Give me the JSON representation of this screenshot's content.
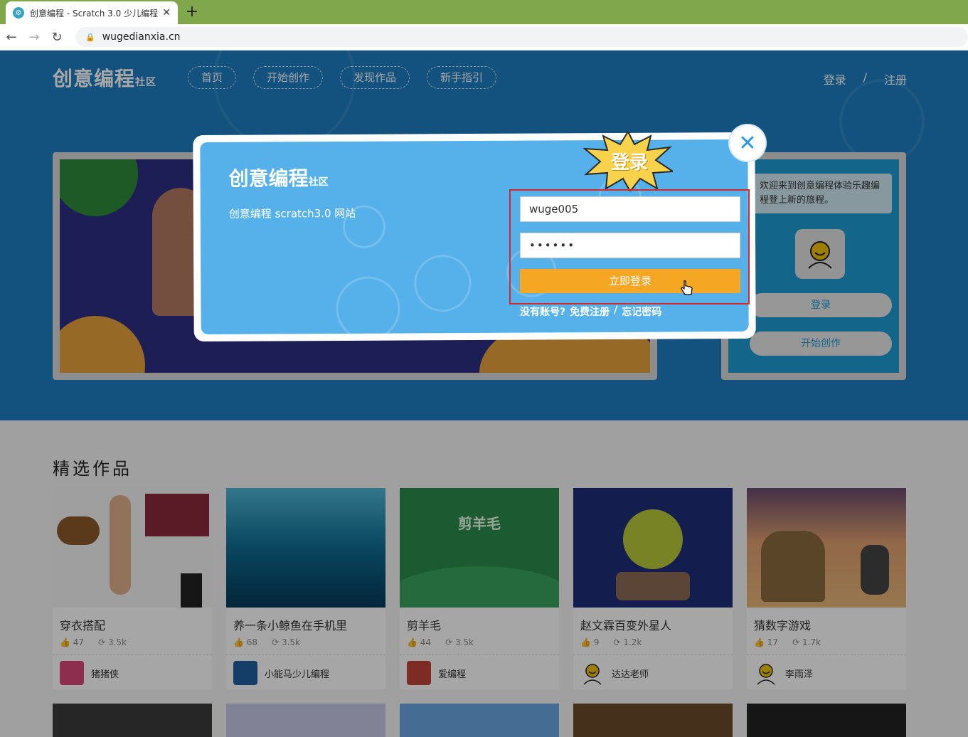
{
  "browser": {
    "tab_title": "创意编程 - Scratch 3.0 少儿编程",
    "tab_close": "✕",
    "new_tab": "+",
    "url": "wugedianxia.cn"
  },
  "site": {
    "logo_main": "创意编程",
    "logo_suffix": "社区",
    "nav": [
      "首页",
      "开始创作",
      "发现作品",
      "新手指引"
    ],
    "login": "登录",
    "separator": "/",
    "register": "注册"
  },
  "sidebar": {
    "welcome": "欢迎来到创意编程体验乐趣编程登上新的旅程。",
    "login_button": "登录",
    "create_button": "开始创作"
  },
  "featured": {
    "title": "精选作品",
    "cards": [
      {
        "title": "穿衣搭配",
        "likes": "47",
        "remixes": "3.5k",
        "author": "猪猪侠"
      },
      {
        "title": "养一条小鲸鱼在手机里",
        "likes": "68",
        "remixes": "3.5k",
        "author": "小能马少儿编程"
      },
      {
        "title": "剪羊毛",
        "likes": "44",
        "remixes": "3.5k",
        "author": "爱编程"
      },
      {
        "title": "赵文霖百变外星人",
        "likes": "9",
        "remixes": "1.2k",
        "author": "达达老师"
      },
      {
        "title": "猜数字游戏",
        "likes": "17",
        "remixes": "1.7k",
        "author": "李雨泽"
      }
    ],
    "card3_thumb_title": "剪羊毛"
  },
  "modal": {
    "logo_main": "创意编程",
    "logo_suffix": "社区",
    "subtitle": "创意编程 scratch3.0 网站",
    "badge": "登录",
    "username_value": "wuge005",
    "password_value": "••••••",
    "submit": "立即登录",
    "no_account": "没有账号?",
    "free_register": "免费注册",
    "slash": "/",
    "forgot": "忘记密码",
    "close": "✕"
  },
  "colors": {
    "hero_bg": "#1e7fc2",
    "modal_bg": "#56b1ea",
    "accent_orange": "#f5a623",
    "highlight_red": "#d8292a"
  }
}
